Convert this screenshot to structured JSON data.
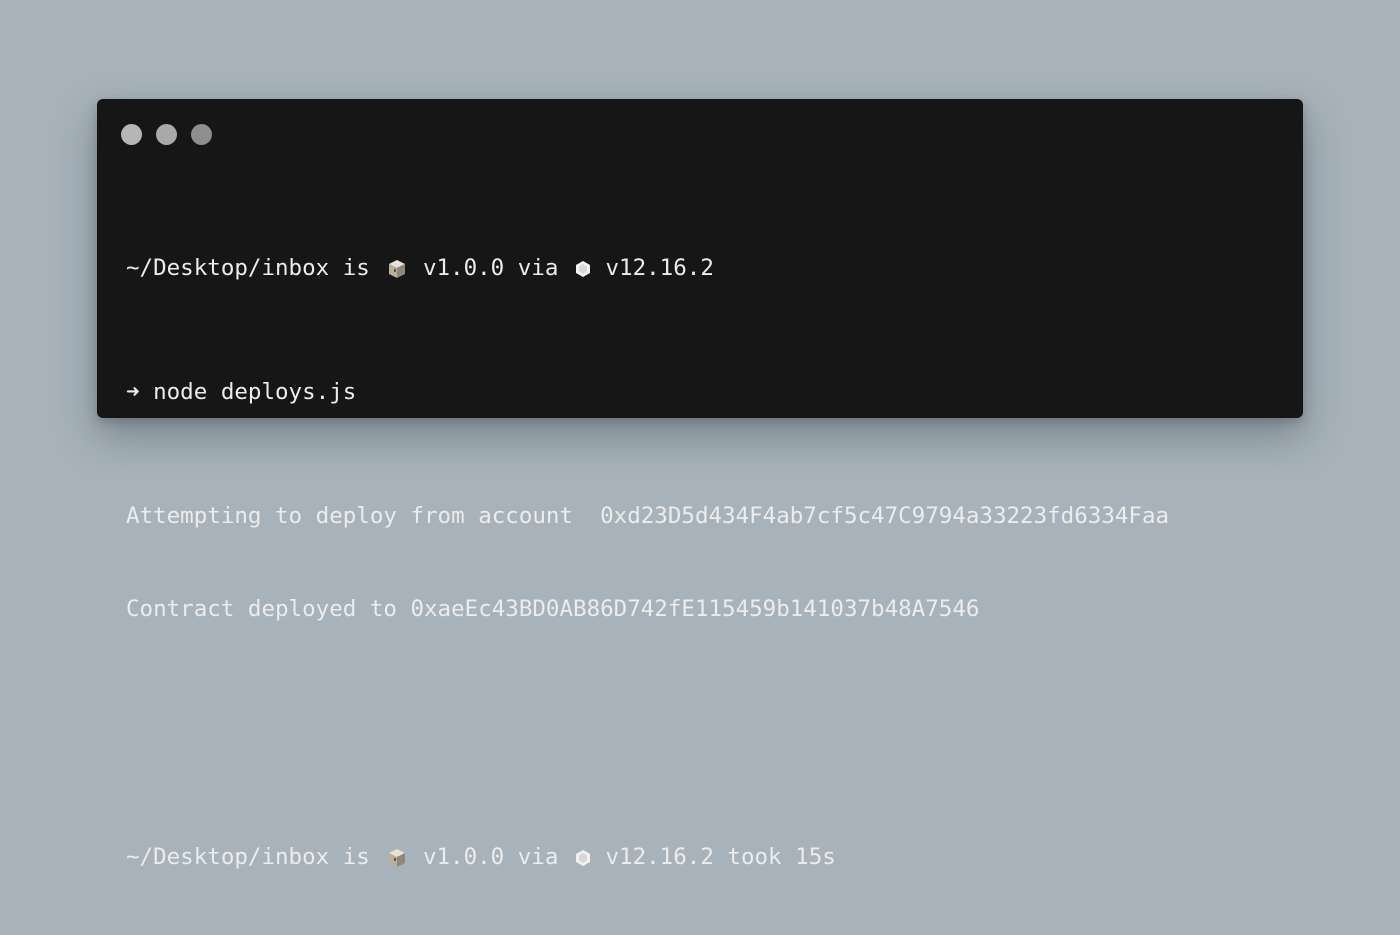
{
  "window": {
    "controls": [
      "close",
      "minimize",
      "maximize"
    ]
  },
  "terminal": {
    "prompt1": {
      "path": "~/Desktop/inbox",
      "is": "is",
      "package_icon": "package-icon",
      "package_version": "v1.0.0",
      "via": "via",
      "node_icon": "nodejs-icon",
      "node_version": "v12.16.2"
    },
    "command": {
      "arrow": "➜",
      "text": "node deploys.js"
    },
    "output": [
      "Attempting to deploy from account  0xd23D5d434F4ab7cf5c47C9794a33223fd6334Faa",
      "Contract deployed to 0xaeEc43BD0AB86D742fE115459b141037b48A7546"
    ],
    "prompt2": {
      "path": "~/Desktop/inbox",
      "is": "is",
      "package_icon": "package-icon",
      "package_version": "v1.0.0",
      "via": "via",
      "node_icon": "nodejs-icon",
      "node_version": "v12.16.2",
      "took": "took",
      "duration": "15s"
    }
  }
}
